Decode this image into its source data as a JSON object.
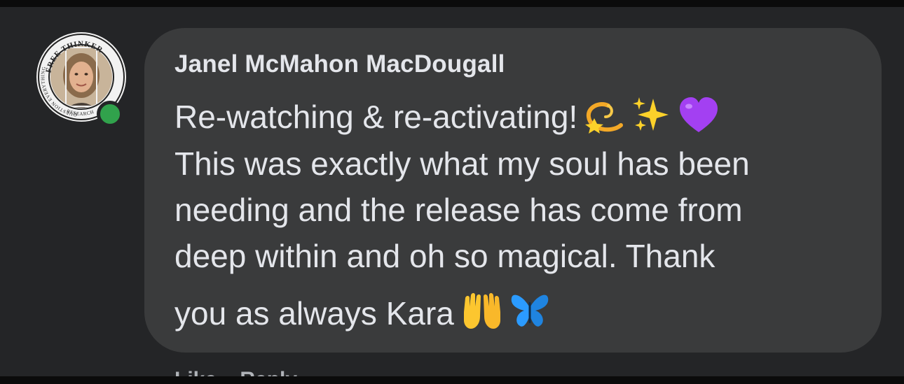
{
  "comment": {
    "author": "Janel McMahon MacDougall",
    "avatar": {
      "ring_text_top": "FREE THINKER",
      "ring_text_left": "QUESTION EVERYTHING",
      "ring_text_bottom": "RESEARCH",
      "online": true
    },
    "lines": [
      "Re-watching & re-activating!",
      "This was exactly what my soul has been",
      "needing and the release has come from",
      "deep within and oh so magical. Thank",
      "you as always Kara"
    ],
    "emojis_line1": [
      "dizzy-emoji",
      "sparkles-emoji",
      "purple-heart-emoji"
    ],
    "emojis_line5": [
      "raising-hands-emoji",
      "butterfly-emoji"
    ]
  },
  "actions": {
    "like_label": "Like",
    "reply_label": "Reply"
  },
  "colors": {
    "background": "#242527",
    "bubble": "#3a3b3c",
    "text": "#e4e6eb",
    "online": "#31a24c"
  }
}
